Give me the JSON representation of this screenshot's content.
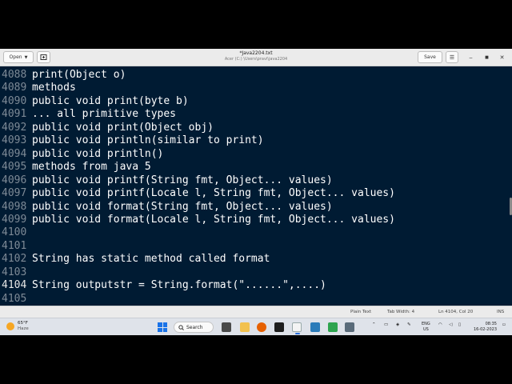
{
  "window": {
    "title": "*Java2204.txt",
    "subtitle": "Acer (C:) \\Users\\pravi\\java2204",
    "open_label": "Open",
    "save_label": "Save"
  },
  "editor": {
    "current_line": "4104",
    "lines": [
      {
        "n": "4088",
        "text": "print(Object o)"
      },
      {
        "n": "4089",
        "text": "methods"
      },
      {
        "n": "4090",
        "text": "public void print(byte b)"
      },
      {
        "n": "4091",
        "text": "... all primitive types"
      },
      {
        "n": "4092",
        "text": "public void print(Object obj)"
      },
      {
        "n": "4093",
        "text": "public void println(similar to print)"
      },
      {
        "n": "4094",
        "text": "public void println()"
      },
      {
        "n": "4095",
        "text": "methods from java 5"
      },
      {
        "n": "4096",
        "text": "public void printf(String fmt, Object... values)"
      },
      {
        "n": "4097",
        "text": "public void printf(Locale l, String fmt, Object... values)"
      },
      {
        "n": "4098",
        "text": "public void format(String fmt, Object... values)"
      },
      {
        "n": "4099",
        "text": "public void format(Locale l, String fmt, Object... values)"
      },
      {
        "n": "4100",
        "text": ""
      },
      {
        "n": "4101",
        "text": ""
      },
      {
        "n": "4102",
        "text": "String has static method called format"
      },
      {
        "n": "4103",
        "text": ""
      },
      {
        "n": "4104",
        "text": "String outputstr = String.format(\"......\",....)"
      },
      {
        "n": "4105",
        "text": ""
      }
    ]
  },
  "statusbar": {
    "syntax": "Plain Text",
    "tab_width": "Tab Width: 4",
    "position": "Ln 4104, Col 20",
    "mode": "INS"
  },
  "taskbar": {
    "weather_temp": "65°F",
    "weather_desc": "Haze",
    "search_label": "Search",
    "lang_top": "ENG",
    "lang_bottom": "US",
    "time": "08:35",
    "date": "16-02-2023"
  },
  "colors": {
    "editor_bg": "#001b33",
    "editor_text": "#ffffff",
    "line_number": "#7e8a96"
  }
}
